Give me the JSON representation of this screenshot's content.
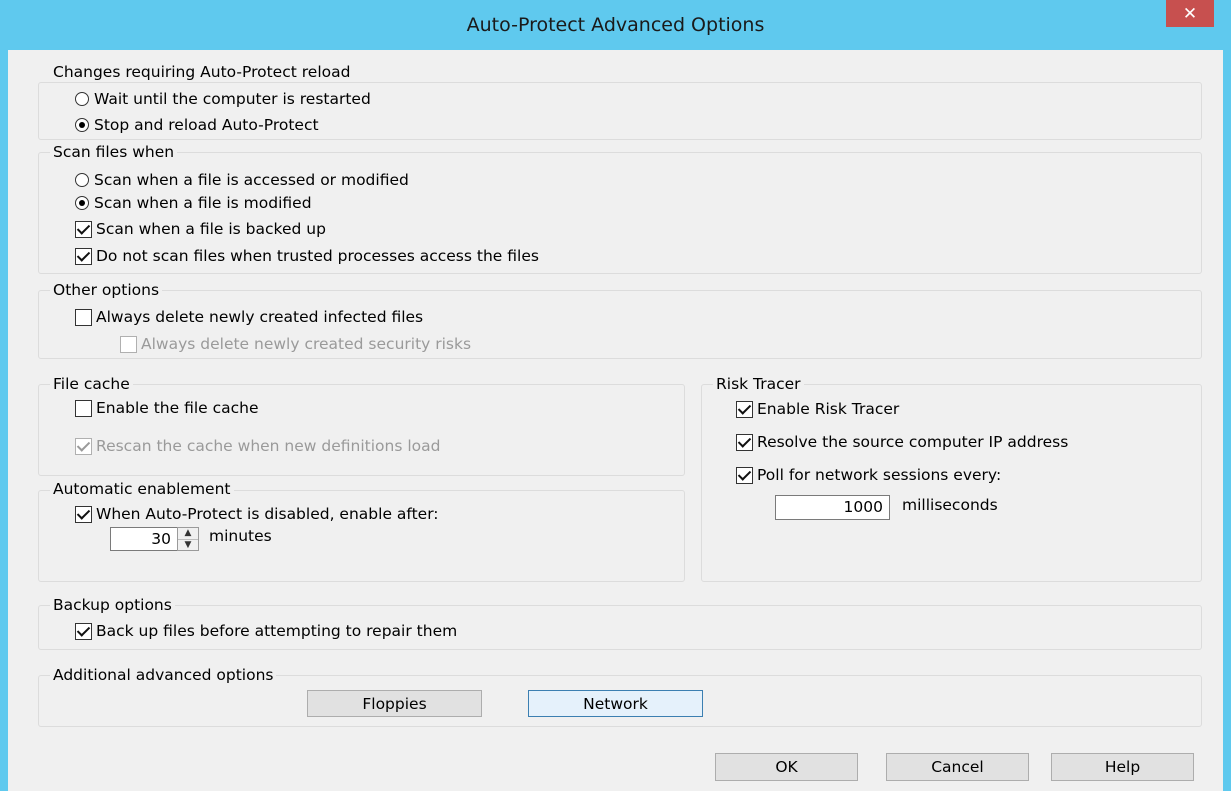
{
  "window": {
    "title": "Auto-Protect Advanced Options",
    "close_glyph": "✕"
  },
  "reload": {
    "legend": "Changes requiring Auto-Protect reload",
    "opt_wait": {
      "label": "Wait until the computer is restarted",
      "selected": false
    },
    "opt_stop": {
      "label": "Stop and reload Auto-Protect",
      "selected": true
    }
  },
  "scan": {
    "legend": "Scan files when",
    "opt_accessed": {
      "label": "Scan when a file is accessed or modified",
      "selected": false
    },
    "opt_modified": {
      "label": "Scan when a file is modified",
      "selected": true
    },
    "backed_up": {
      "label": "Scan when a file is backed up",
      "checked": true
    },
    "trusted": {
      "label": "Do not scan files when trusted processes access the files",
      "checked": true
    }
  },
  "other": {
    "legend": "Other options",
    "delete_infected": {
      "label": "Always delete newly created infected files",
      "checked": false
    },
    "delete_risks": {
      "label": "Always delete newly created security risks",
      "checked": false,
      "enabled": false
    }
  },
  "file_cache": {
    "legend": "File cache",
    "enable": {
      "label": "Enable the file cache",
      "checked": false
    },
    "rescan": {
      "label": "Rescan the cache when new definitions load",
      "checked": true,
      "enabled": false
    }
  },
  "auto_enable": {
    "legend": "Automatic enablement",
    "when_disabled": {
      "label": "When Auto-Protect is disabled, enable after:",
      "checked": true
    },
    "minutes_value": "30",
    "minutes_unit": "minutes"
  },
  "risk_tracer": {
    "legend": "Risk Tracer",
    "enable": {
      "label": "Enable Risk Tracer",
      "checked": true
    },
    "resolve_ip": {
      "label": "Resolve the source computer IP address",
      "checked": true
    },
    "poll": {
      "label": "Poll for network sessions every:",
      "checked": true
    },
    "poll_value": "1000",
    "poll_unit": "milliseconds"
  },
  "backup": {
    "legend": "Backup options",
    "back_up": {
      "label": "Back up files before attempting to repair them",
      "checked": true
    }
  },
  "additional": {
    "legend": "Additional advanced options",
    "floppies": "Floppies",
    "network": "Network"
  },
  "footer": {
    "ok": "OK",
    "cancel": "Cancel",
    "help": "Help"
  }
}
